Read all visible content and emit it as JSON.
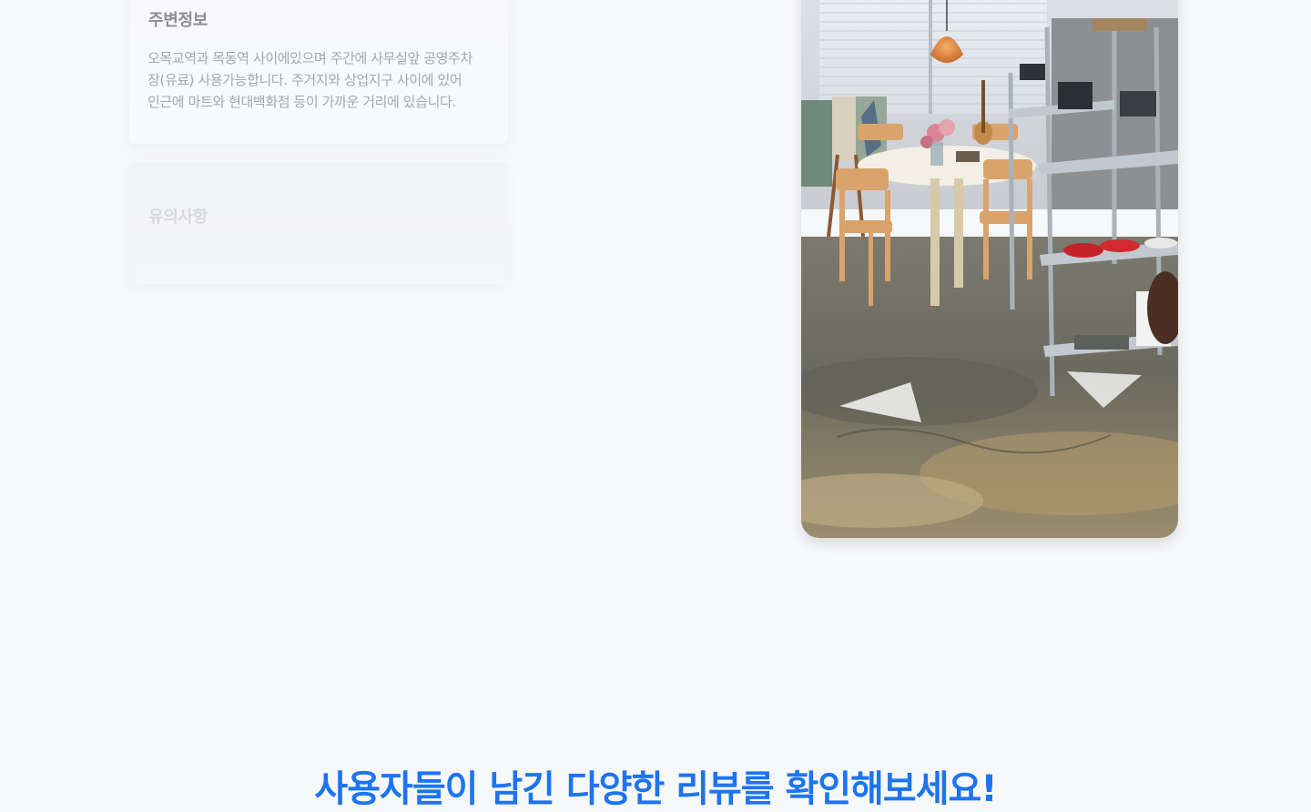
{
  "info_cards": {
    "nearby": {
      "title": "주변정보",
      "body": "오목교역과 목동역 사이에있으며 주간에 사무실앞 공영주차\n장(유료) 사용가능합니다.  주거지와 상업지구 사이에 있어\n인근에 마트와 현대백화점 등이 가까운 거리에 있습니다."
    },
    "notice": {
      "title": "유의사항"
    }
  },
  "gallery": {
    "prev_icon": "chevron-left-icon",
    "next_icon": "chevron-right-icon"
  },
  "reviews_section": {
    "title": "사용자들이 남긴 다양한 리뷰를 확인해보세요!"
  },
  "colors": {
    "accent": "#1d74f0",
    "page_background": "#f7f8fa"
  }
}
